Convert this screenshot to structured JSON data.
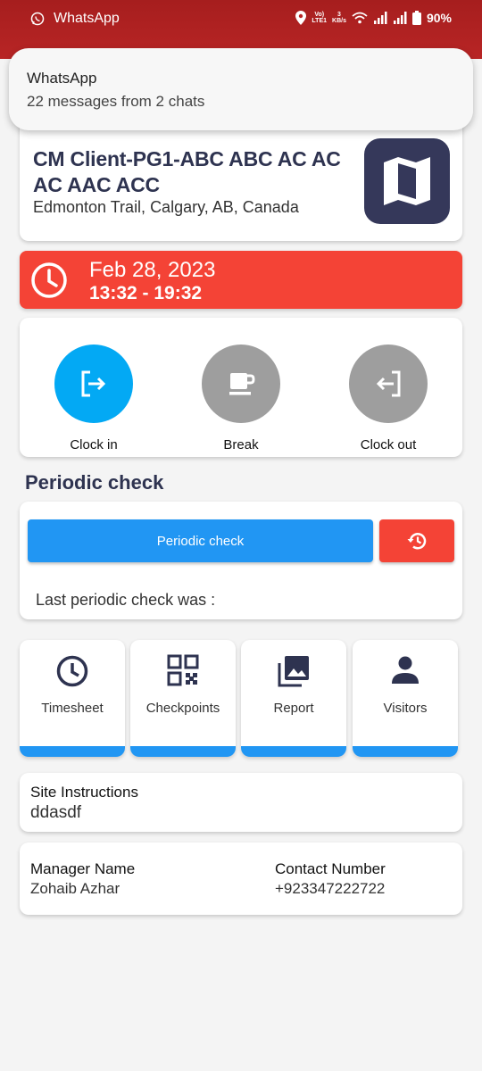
{
  "status_bar": {
    "app_name": "WhatsApp",
    "net_top": "Vo)",
    "net_bottom": "LTE1",
    "speed_top": "3",
    "speed_bottom": "KB/s",
    "battery": "90%"
  },
  "notification": {
    "title": "WhatsApp",
    "text": "22 messages from 2 chats"
  },
  "site": {
    "name": "CM Client-PG1-ABC ABC AC AC AC AAC ACC",
    "address": "Edmonton Trail, Calgary, AB, Canada",
    "icon": "map-icon"
  },
  "shift": {
    "date": "Feb 28, 2023",
    "time": "13:32 - 19:32",
    "color": "#f44336"
  },
  "actions": {
    "clock_in": {
      "label": "Clock in",
      "color": "#03a9f4",
      "icon": "login-icon"
    },
    "break": {
      "label": "Break",
      "color": "#9e9e9e",
      "icon": "coffee-icon"
    },
    "clock_out": {
      "label": "Clock out",
      "color": "#9e9e9e",
      "icon": "logout-icon"
    }
  },
  "periodic": {
    "section_title": "Periodic check",
    "button_label": "Periodic check",
    "last_check_label": "Last periodic check was :",
    "button_color": "#2196f3",
    "history_color": "#f44336"
  },
  "tiles": [
    {
      "label": "Timesheet",
      "icon": "clock-icon"
    },
    {
      "label": "Checkpoints",
      "icon": "qr-code-icon"
    },
    {
      "label": "Report",
      "icon": "image-icon"
    },
    {
      "label": "Visitors",
      "icon": "person-icon"
    }
  ],
  "site_instructions": {
    "label": "Site Instructions",
    "value": "ddasdf"
  },
  "manager": {
    "name_label": "Manager Name",
    "name_value": "Zohaib Azhar",
    "contact_label": "Contact Number",
    "contact_value": "+923347222722"
  }
}
